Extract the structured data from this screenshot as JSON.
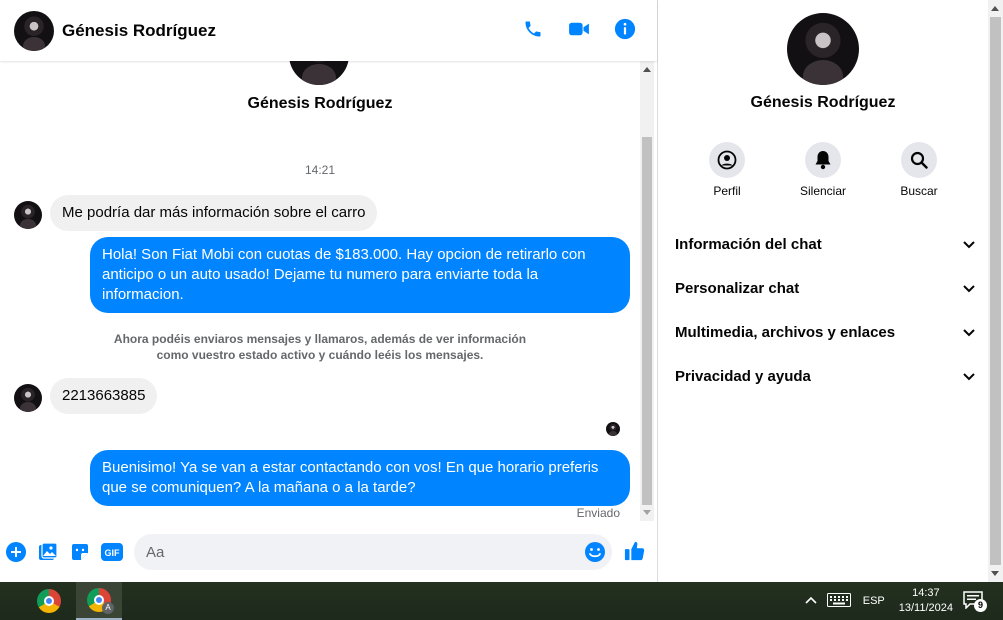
{
  "colors": {
    "accent": "#0084ff",
    "incoming_bubble": "#f0f0f0",
    "muted_text": "#65676b"
  },
  "header": {
    "contact_name": "Génesis Rodríguez",
    "icons": [
      "phone-icon",
      "video-camera-icon",
      "info-icon"
    ]
  },
  "conversation": {
    "contact_name": "Génesis Rodríguez",
    "timestamp": "14:21",
    "messages": [
      {
        "direction": "incoming",
        "text": "Me podría dar más información sobre el carro"
      },
      {
        "direction": "outgoing",
        "text": "Hola! Son Fiat Mobi con cuotas de $183.000. Hay opcion de retirarlo con anticipo o un auto usado! Dejame tu numero para enviarte toda la informacion."
      },
      {
        "direction": "incoming",
        "text": "2213663885"
      },
      {
        "direction": "outgoing",
        "text": "Buenisimo! Ya se van a estar contactando con vos! En que horario preferis que se comuniquen? A la mañana o a la tarde?"
      }
    ],
    "system_note": "Ahora podéis enviaros mensajes y llamaros, además de ver información como vuestro estado activo y cuándo leéis los mensajes.",
    "delivery_status": "Enviado"
  },
  "composer": {
    "placeholder": "Aa",
    "value": "",
    "tools": [
      "add-icon",
      "photo-icon",
      "sticker-icon",
      "gif-icon"
    ],
    "gif_label": "GIF",
    "emoji_icon": "smiley-icon",
    "send_icon": "thumbs-up-icon"
  },
  "panel": {
    "contact_name": "Génesis Rodríguez",
    "actions": [
      {
        "label": "Perfil",
        "icon": "profile-icon"
      },
      {
        "label": "Silenciar",
        "icon": "bell-icon"
      },
      {
        "label": "Buscar",
        "icon": "search-icon"
      }
    ],
    "sections": [
      {
        "label": "Información del chat"
      },
      {
        "label": "Personalizar chat"
      },
      {
        "label": "Multimedia, archivos y enlaces"
      },
      {
        "label": "Privacidad y ayuda"
      }
    ]
  },
  "taskbar": {
    "language": "ESP",
    "time": "14:37",
    "date": "13/11/2024",
    "notification_count": "9",
    "chrome_profile_badge": "A"
  }
}
